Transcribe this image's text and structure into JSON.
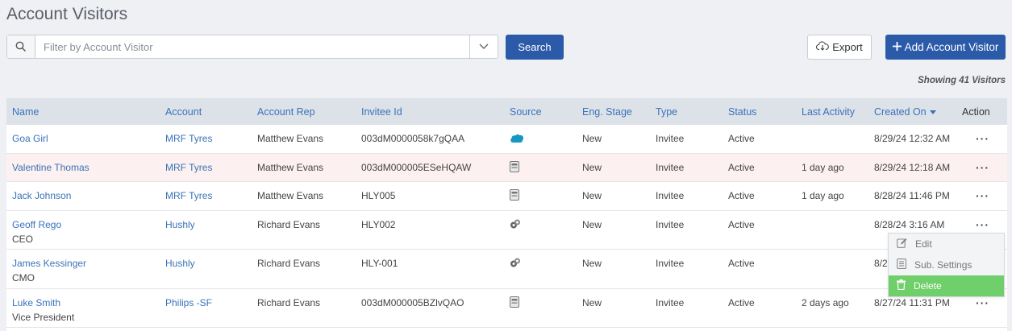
{
  "title": "Account Visitors",
  "filter": {
    "placeholder": "Filter by Account Visitor"
  },
  "search_label": "Search",
  "export_label": "Export",
  "add_label": "Add Account Visitor",
  "visitor_count": "Showing 41 Visitors",
  "columns": {
    "name": "Name",
    "account": "Account",
    "account_rep": "Account Rep",
    "invitee_id": "Invitee Id",
    "source": "Source",
    "eng_stage": "Eng. Stage",
    "type": "Type",
    "status": "Status",
    "last_activity": "Last Activity",
    "created_on": "Created On",
    "action": "Action"
  },
  "rows": [
    {
      "name": "Goa Girl",
      "title": "",
      "account": "MRF Tyres",
      "rep": "Matthew Evans",
      "invitee": "003dM0000058k7gQAA",
      "source_icon": "salesforce-icon",
      "stage": "New",
      "type": "Invitee",
      "status": "Active",
      "activity": "",
      "created": "8/29/24 12:32 AM"
    },
    {
      "name": "Valentine Thomas",
      "title": "",
      "account": "MRF Tyres",
      "rep": "Matthew Evans",
      "invitee": "003dM000005ESeHQAW",
      "source_icon": "form-icon",
      "stage": "New",
      "type": "Invitee",
      "status": "Active",
      "activity": "1 day ago",
      "created": "8/29/24 12:18 AM"
    },
    {
      "name": "Jack Johnson",
      "title": "",
      "account": "MRF Tyres",
      "rep": "Matthew Evans",
      "invitee": "HLY005",
      "source_icon": "form-icon",
      "stage": "New",
      "type": "Invitee",
      "status": "Active",
      "activity": "1 day ago",
      "created": "8/28/24 11:46 PM"
    },
    {
      "name": "Geoff Rego",
      "title": "CEO",
      "account": "Hushly",
      "rep": "Richard Evans",
      "invitee": "HLY002",
      "source_icon": "hushly-icon",
      "stage": "New",
      "type": "Invitee",
      "status": "Active",
      "activity": "",
      "created": "8/28/24 3:16 AM"
    },
    {
      "name": "James Kessinger",
      "title": "CMO",
      "account": "Hushly",
      "rep": "Richard Evans",
      "invitee": "HLY-001",
      "source_icon": "hushly-icon",
      "stage": "New",
      "type": "Invitee",
      "status": "Active",
      "activity": "",
      "created": "8/2"
    },
    {
      "name": "Luke Smith",
      "title": "Vice President",
      "account": "Philips -SF",
      "rep": "Richard Evans",
      "invitee": "003dM000005BZlvQAO",
      "source_icon": "form-icon",
      "stage": "New",
      "type": "Invitee",
      "status": "Active",
      "activity": "2 days ago",
      "created": "8/27/24 11:31 PM"
    }
  ],
  "context_menu": {
    "edit": "Edit",
    "sub_settings": "Sub. Settings",
    "delete": "Delete"
  },
  "colors": {
    "primary": "#2a5aa8",
    "link": "#3a72b8",
    "delete": "#6fcf6a",
    "highlight_row": "#fcf0f0"
  }
}
